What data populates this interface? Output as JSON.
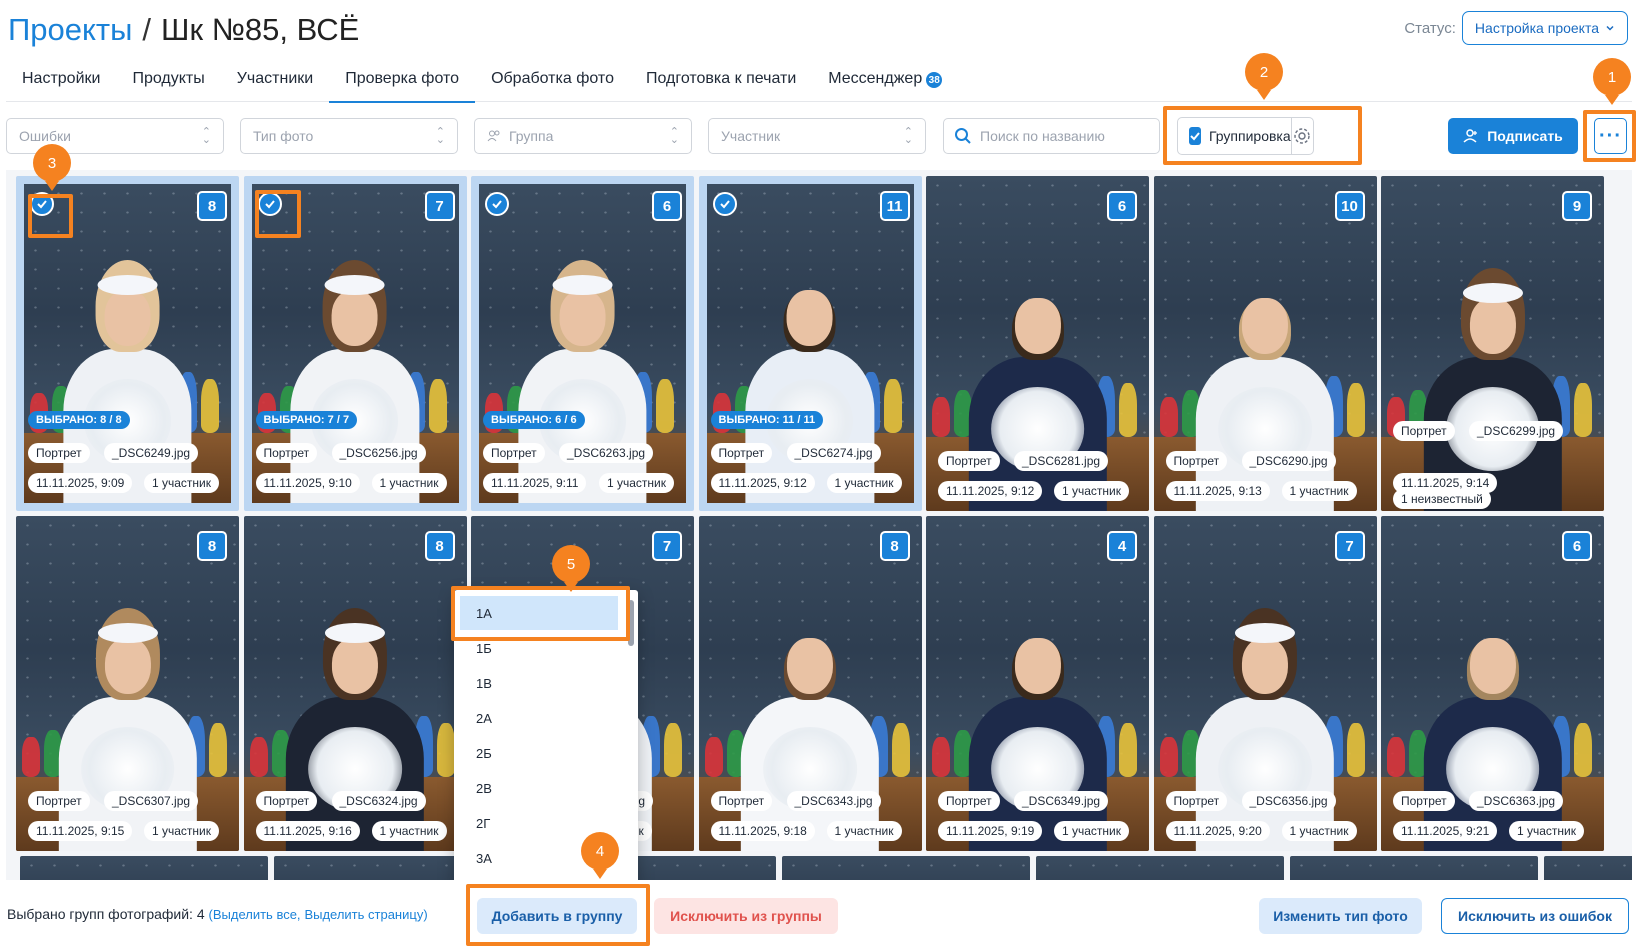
{
  "header": {
    "crumb": "Проекты",
    "separator": "/",
    "title": "Шк №85, ВСЁ"
  },
  "status": {
    "label": "Статус:",
    "value": "Настройка проекта"
  },
  "tabs": [
    {
      "label": "Настройки"
    },
    {
      "label": "Продукты"
    },
    {
      "label": "Участники"
    },
    {
      "label": "Проверка фото",
      "active": true
    },
    {
      "label": "Обработка фото"
    },
    {
      "label": "Подготовка к печати"
    },
    {
      "label": "Мессенджер",
      "badge": "38"
    }
  ],
  "filters": {
    "errors_placeholder": "Ошибки",
    "phototype_placeholder": "Тип фото",
    "group_placeholder": "Группа",
    "participant_placeholder": "Участник",
    "search_placeholder": "Поиск по названию",
    "grouping_label": "Группировка",
    "grouping_checked": true
  },
  "sign_button": "Подписать",
  "annotations": [
    "1",
    "2",
    "3",
    "4",
    "5"
  ],
  "photos": [
    {
      "count": "8",
      "selected": true,
      "chosen": "ВЫБРАНО: 8 / 8",
      "type": "Портрет",
      "file": "_DSC6249.jpg",
      "time": "11.11.2025, 9:09",
      "participants": "1 участник"
    },
    {
      "count": "7",
      "selected": true,
      "chosen": "ВЫБРАНО: 7 / 7",
      "type": "Портрет",
      "file": "_DSC6256.jpg",
      "time": "11.11.2025, 9:10",
      "participants": "1 участник"
    },
    {
      "count": "6",
      "selected": true,
      "chosen": "ВЫБРАНО: 6 / 6",
      "type": "Портрет",
      "file": "_DSC6263.jpg",
      "time": "11.11.2025, 9:11",
      "participants": "1 участник"
    },
    {
      "count": "11",
      "selected": true,
      "chosen": "ВЫБРАНО: 11 / 11",
      "type": "Портрет",
      "file": "_DSC6274.jpg",
      "time": "11.11.2025, 9:12",
      "participants": "1 участник"
    },
    {
      "count": "6",
      "selected": false,
      "type": "Портрет",
      "file": "_DSC6281.jpg",
      "time": "11.11.2025, 9:12",
      "participants": "1 участник"
    },
    {
      "count": "10",
      "selected": false,
      "type": "Портрет",
      "file": "_DSC6290.jpg",
      "time": "11.11.2025, 9:13",
      "participants": "1 участник"
    },
    {
      "count": "9",
      "selected": false,
      "type": "Портрет",
      "file": "_DSC6299.jpg",
      "time": "11.11.2025, 9:14",
      "participants": "1 неизвестный"
    },
    {
      "count": "8",
      "selected": false,
      "type": "Портрет",
      "file": "_DSC6307.jpg",
      "time": "11.11.2025, 9:15",
      "participants": "1 участник"
    },
    {
      "count": "8",
      "selected": false,
      "type": "Портрет",
      "file": "_DSC6324.jpg",
      "time": "11.11.2025, 9:16",
      "participants": "1 участник"
    },
    {
      "count": "7",
      "selected": false,
      "type": "",
      "file": "jpg",
      "time": "",
      "participants": "астник"
    },
    {
      "count": "8",
      "selected": false,
      "type": "Портрет",
      "file": "_DSC6343.jpg",
      "time": "11.11.2025, 9:18",
      "participants": "1 участник"
    },
    {
      "count": "4",
      "selected": false,
      "type": "Портрет",
      "file": "_DSC6349.jpg",
      "time": "11.11.2025, 9:19",
      "participants": "1 участник"
    },
    {
      "count": "7",
      "selected": false,
      "type": "Портрет",
      "file": "_DSC6356.jpg",
      "time": "11.11.2025, 9:20",
      "participants": "1 участник"
    },
    {
      "count": "6",
      "selected": false,
      "type": "Портрет",
      "file": "_DSC6363.jpg",
      "time": "11.11.2025, 9:21",
      "participants": "1 участник"
    }
  ],
  "group_dropdown": [
    "1А",
    "1Б",
    "1В",
    "2А",
    "2Б",
    "2В",
    "2Г",
    "3А"
  ],
  "bottom": {
    "selected_text": "Выбрано групп фотографий: 4",
    "select_all": "(Выделить все,",
    "select_page": "Выделить страницу)",
    "add_to_group": "Добавить в группу",
    "exclude_from_group": "Исключить из группы",
    "change_type": "Изменить тип фото",
    "exclude_from_errors": "Исключить из ошибок"
  },
  "colors": {
    "accent": "#1a82d8",
    "annotation": "#f58220",
    "danger_text": "#e0524d"
  }
}
